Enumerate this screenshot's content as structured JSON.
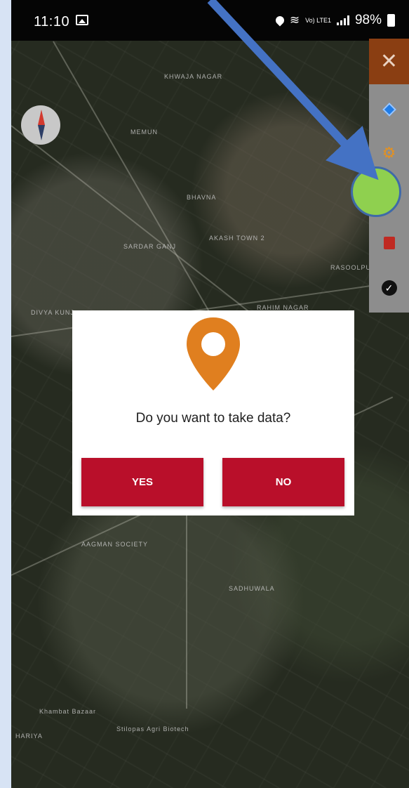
{
  "status_bar": {
    "time": "11:10",
    "lte_label": "Vo) LTE1",
    "battery": "98%"
  },
  "map": {
    "labels": [
      "KHWAJA NAGAR",
      "MEMUN",
      "AKASH TOWN 2",
      "SARDAR GANJ",
      "RAHIM NAGAR",
      "AAGMAN SOCIETY",
      "BHAVNA",
      "RASOOLPURA",
      "SADHUWALA",
      "HARIYA",
      "DIVYA KUNJ",
      "Stilopas Agri Biotech",
      "Khambat Bazaar"
    ]
  },
  "toolbar": {
    "close_label": "✕",
    "check_label": "✓",
    "gears_label": "⚙"
  },
  "dialog": {
    "question": "Do you want to take data?",
    "yes_label": "YES",
    "no_label": "NO"
  },
  "colors": {
    "dialog_button": "#b90f2a",
    "marker": "#e07f1f",
    "close_bg": "#8a3e12",
    "highlight_dot": "#8fd04f",
    "annotation_arrow": "#4472c4"
  }
}
